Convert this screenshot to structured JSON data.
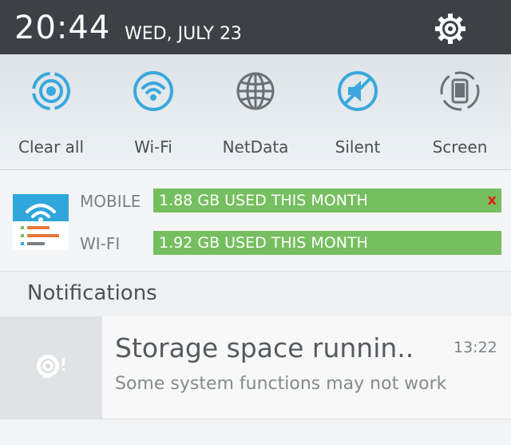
{
  "status_bar": {
    "time": "20:44",
    "date": "WED, JULY 23",
    "settings_icon": "gear-icon",
    "background": "#3d4147"
  },
  "quick_settings": {
    "accent": "#3aa8dc",
    "items": [
      {
        "label": "Clear all",
        "icon": "clear-all-icon"
      },
      {
        "label": "Wi-Fi",
        "icon": "wifi-icon"
      },
      {
        "label": "NetData",
        "icon": "globe-icon"
      },
      {
        "label": "Silent",
        "icon": "silent-icon"
      },
      {
        "label": "Screen",
        "icon": "screen-rotate-icon"
      }
    ]
  },
  "data_widget": {
    "app_icon": "data-usage-app-icon",
    "bar_color": "#76bf60",
    "rows": [
      {
        "label": "MOBILE",
        "usage": "1.88 GB USED THIS MONTH",
        "close": "x"
      },
      {
        "label": "WI-FI",
        "usage": "1.92 GB USED THIS MONTH"
      }
    ]
  },
  "notifications": {
    "header": "Notifications",
    "items": [
      {
        "icon": "storage-warning-icon",
        "title": "Storage space runnin..",
        "time": "13:22",
        "body": "Some system functions may not work"
      }
    ]
  }
}
